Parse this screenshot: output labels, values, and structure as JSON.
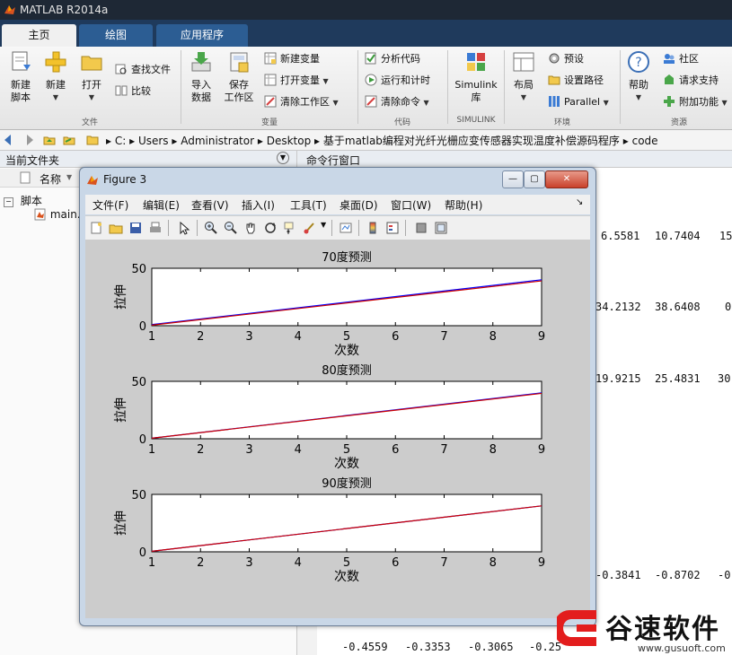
{
  "window": {
    "title": "MATLAB R2014a"
  },
  "tabs": [
    "主页",
    "绘图",
    "应用程序"
  ],
  "ribbon": {
    "file": {
      "label": "文件",
      "new_script": [
        "新建",
        "脚本"
      ],
      "new": "新建",
      "open": "打开",
      "find_files": "查找文件",
      "compare": "比较"
    },
    "variable": {
      "label": "变量",
      "import": [
        "导入",
        "数据"
      ],
      "save": [
        "保存",
        "工作区"
      ],
      "new_var": "新建变量",
      "open_var": "打开变量",
      "clear_ws": "清除工作区"
    },
    "code": {
      "label": "代码",
      "analyze": "分析代码",
      "run_time": "运行和计时",
      "clear_cmd": "清除命令"
    },
    "simulink": {
      "label": "SIMULINK",
      "lib": [
        "Simulink",
        "库"
      ]
    },
    "env": {
      "label": "环境",
      "layout": "布局",
      "prefs": "预设",
      "path": "设置路径",
      "parallel": "Parallel"
    },
    "resources": {
      "label": "资源",
      "help": "帮助",
      "community": "社区",
      "support": "请求支持",
      "addons": "附加功能"
    }
  },
  "address": {
    "crumbs": [
      "C:",
      "Users",
      "Administrator",
      "Desktop",
      "基于matlab编程对光纤光栅应变传感器实现温度补偿源码程序",
      "code"
    ]
  },
  "left_panel": {
    "title": "当前文件夹",
    "col_name": "名称",
    "group": "脚本",
    "file": "main."
  },
  "right_panel": {
    "title": "命令行窗口",
    "rows": [
      [
        "6.5581",
        "10.7404",
        "15"
      ],
      [
        "34.2132",
        "38.6408",
        "0"
      ],
      [
        "19.9215",
        "25.4831",
        "30"
      ],
      [
        "-0.3841",
        "-0.8702",
        "-0"
      ],
      [
        "-0.4559",
        "-0.3353",
        "-0.3065",
        "-0.25"
      ]
    ]
  },
  "figure": {
    "title": "Figure 3",
    "menu": [
      "文件(F)",
      "编辑(E)",
      "查看(V)",
      "插入(I)",
      "工具(T)",
      "桌面(D)",
      "窗口(W)",
      "帮助(H)"
    ]
  },
  "chart_data": [
    {
      "type": "line",
      "title": "70度预测",
      "xlabel": "次数",
      "ylabel": "拉伸",
      "xlim": [
        1,
        9
      ],
      "ylim": [
        0,
        50
      ],
      "xticks": [
        1,
        2,
        3,
        4,
        5,
        6,
        7,
        8,
        9
      ],
      "yticks": [
        0,
        50
      ],
      "series": [
        {
          "color": "#0000ff",
          "x": [
            1,
            9
          ],
          "y": [
            1,
            40
          ]
        },
        {
          "color": "#cc0000",
          "x": [
            1,
            9
          ],
          "y": [
            0.5,
            39
          ]
        }
      ]
    },
    {
      "type": "line",
      "title": "80度预测",
      "xlabel": "次数",
      "ylabel": "拉伸",
      "xlim": [
        1,
        9
      ],
      "ylim": [
        0,
        50
      ],
      "xticks": [
        1,
        2,
        3,
        4,
        5,
        6,
        7,
        8,
        9
      ],
      "yticks": [
        0,
        50
      ],
      "series": [
        {
          "color": "#0000ff",
          "x": [
            1,
            9
          ],
          "y": [
            0.5,
            40
          ]
        },
        {
          "color": "#cc0000",
          "x": [
            1,
            9
          ],
          "y": [
            0.5,
            39.5
          ]
        }
      ]
    },
    {
      "type": "line",
      "title": "90度预测",
      "xlabel": "次数",
      "ylabel": "拉伸",
      "xlim": [
        1,
        9
      ],
      "ylim": [
        0,
        50
      ],
      "xticks": [
        1,
        2,
        3,
        4,
        5,
        6,
        7,
        8,
        9
      ],
      "yticks": [
        0,
        50
      ],
      "series": [
        {
          "color": "#0000ff",
          "x": [
            1,
            9
          ],
          "y": [
            0.5,
            40
          ]
        },
        {
          "color": "#cc0000",
          "x": [
            1,
            9
          ],
          "y": [
            0.5,
            40
          ]
        }
      ]
    }
  ],
  "watermark": {
    "brand": "谷速软件",
    "url": "www.gusuoft.com"
  },
  "colors": {
    "titlebar": "#1e2835",
    "tabrow": "#1f3a5c",
    "tab_inactive": "#2c5d93",
    "figure_frame": "#c9d7e7"
  }
}
